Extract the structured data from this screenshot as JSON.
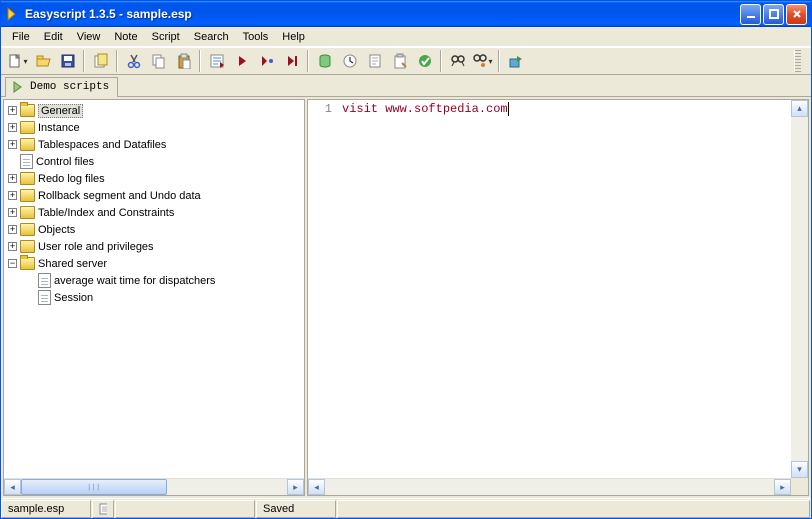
{
  "window": {
    "title": "Easyscript 1.3.5 - sample.esp"
  },
  "menus": [
    "File",
    "Edit",
    "View",
    "Note",
    "Script",
    "Search",
    "Tools",
    "Help"
  ],
  "toolbar_icons": [
    "new",
    "open",
    "save",
    "recent",
    "cut",
    "copy",
    "paste",
    "execute-list",
    "run",
    "run-step",
    "run-to",
    "db",
    "clock",
    "doc",
    "clipboard",
    "check",
    "find",
    "find-settings",
    "export"
  ],
  "tab": {
    "label": "Demo scripts"
  },
  "tree": [
    {
      "depth": 0,
      "exp": "+",
      "icon": "folder-open",
      "label": "General",
      "selected": true
    },
    {
      "depth": 0,
      "exp": "+",
      "icon": "folder",
      "label": "Instance"
    },
    {
      "depth": 0,
      "exp": "+",
      "icon": "folder",
      "label": "Tablespaces and Datafiles"
    },
    {
      "depth": 0,
      "exp": "none",
      "icon": "file",
      "label": "Control files"
    },
    {
      "depth": 0,
      "exp": "+",
      "icon": "folder",
      "label": "Redo log files"
    },
    {
      "depth": 0,
      "exp": "+",
      "icon": "folder",
      "label": "Rollback segment and Undo data"
    },
    {
      "depth": 0,
      "exp": "+",
      "icon": "folder",
      "label": "Table/Index and Constraints"
    },
    {
      "depth": 0,
      "exp": "+",
      "icon": "folder",
      "label": "Objects"
    },
    {
      "depth": 0,
      "exp": "+",
      "icon": "folder",
      "label": "User role and privileges"
    },
    {
      "depth": 0,
      "exp": "-",
      "icon": "folder-open",
      "label": "Shared server"
    },
    {
      "depth": 1,
      "exp": "none",
      "icon": "file",
      "label": "average wait time for dispatchers"
    },
    {
      "depth": 1,
      "exp": "none",
      "icon": "file",
      "label": "Session"
    }
  ],
  "editor": {
    "line_number": "1",
    "line": "visit www.softpedia.com"
  },
  "status": {
    "file": "sample.esp",
    "saved": "Saved"
  }
}
